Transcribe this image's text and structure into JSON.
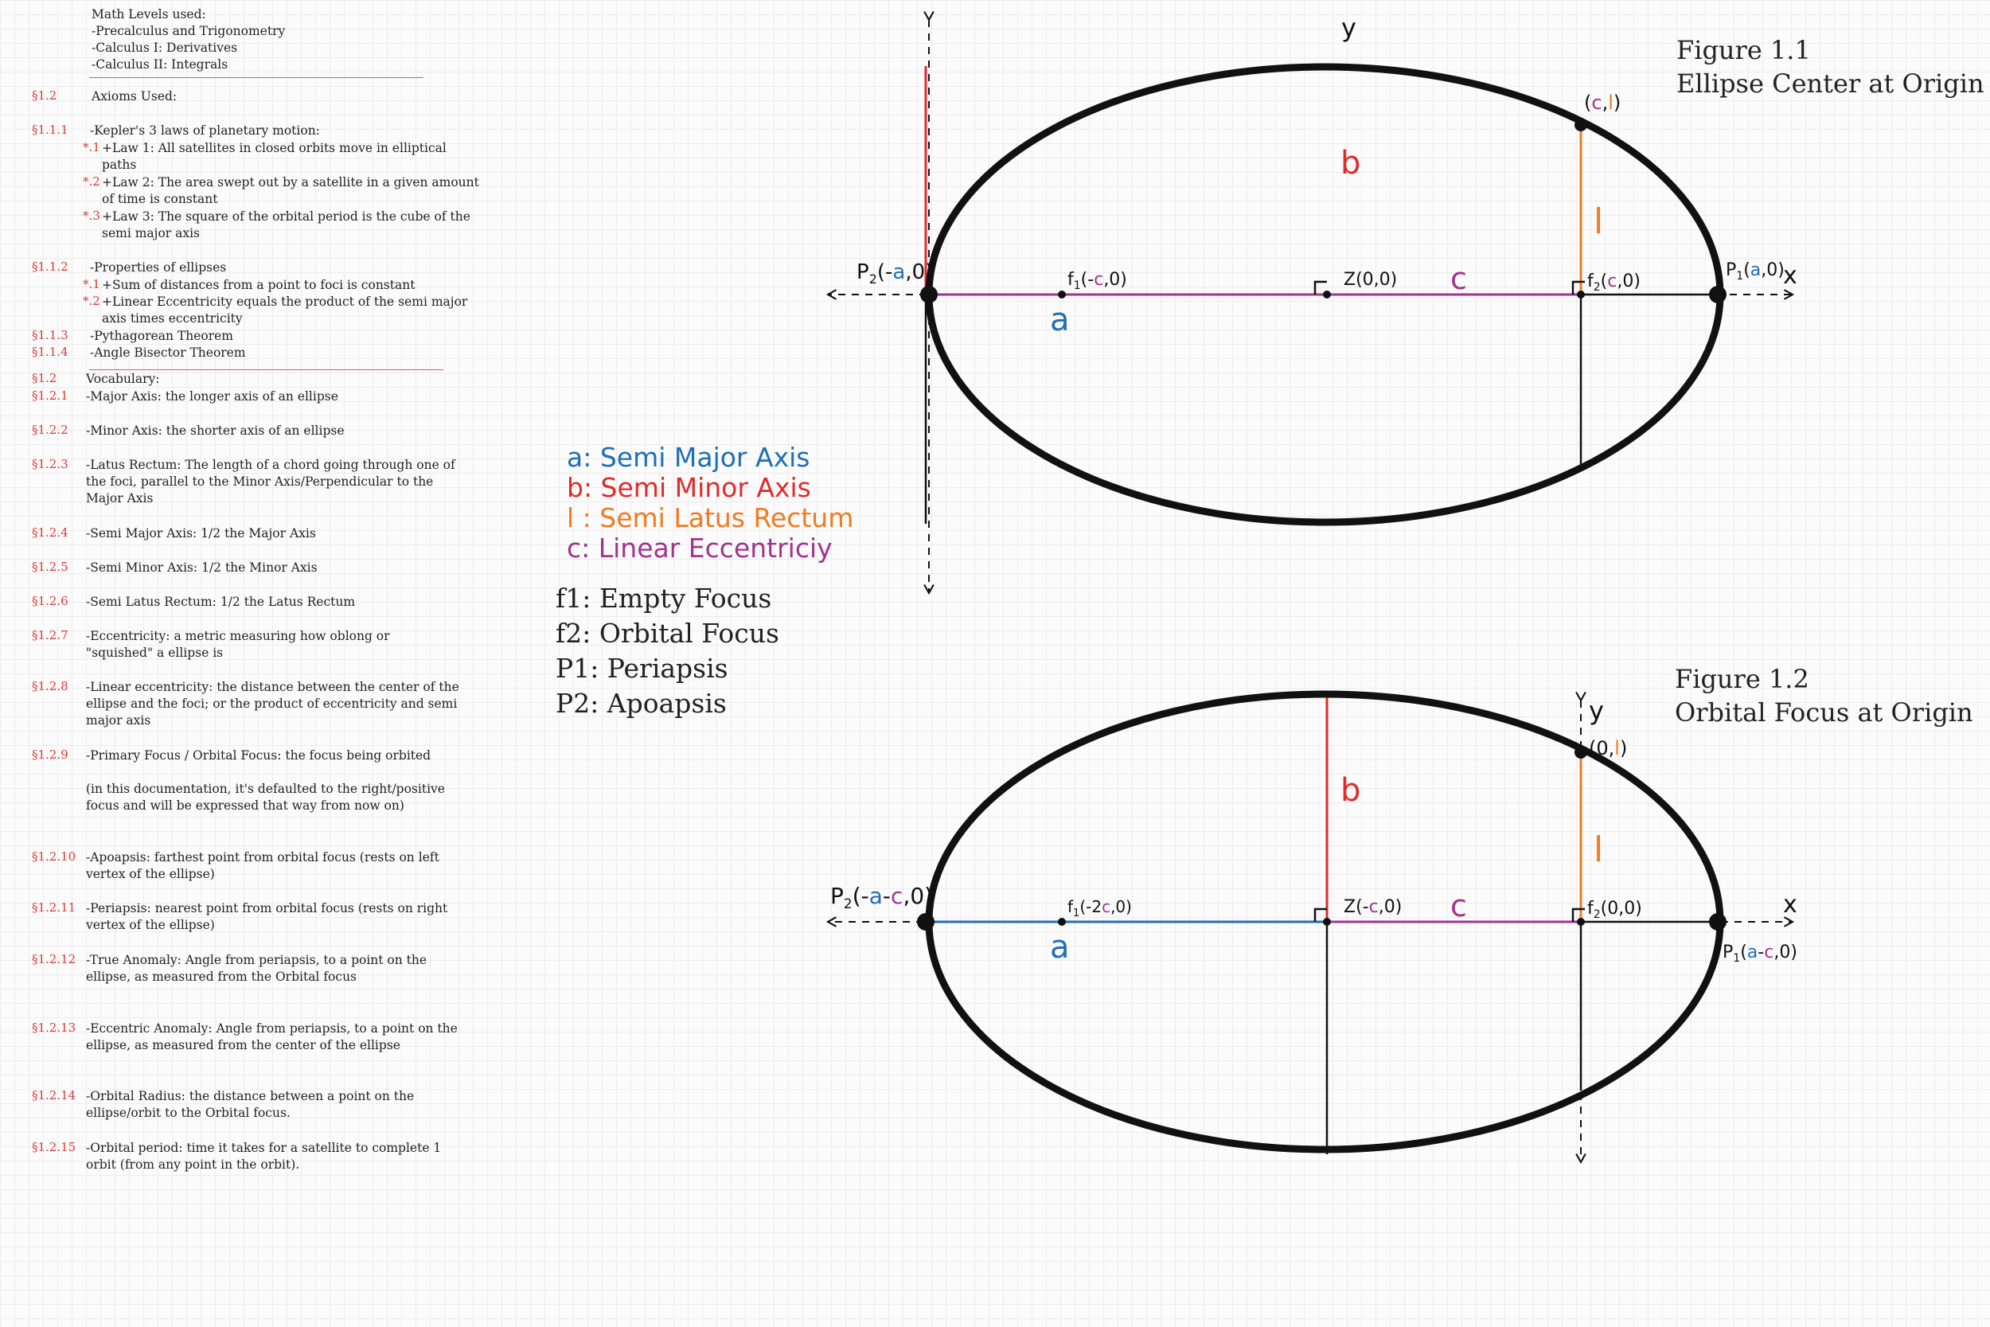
{
  "preface": {
    "lines": [
      "Math Levels used:",
      "-Precalculus and Trigonometry",
      "-Calculus I: Derivatives",
      "-Calculus II: Integrals"
    ]
  },
  "axioms": {
    "header": {
      "num": "§1.2",
      "text": "Axioms Used:"
    },
    "kepler": {
      "num": "§1.1.1",
      "text": "-Kepler's 3 laws of planetary motion:"
    },
    "laws": [
      {
        "num": "*.1",
        "text": "+Law 1: All satellites in closed orbits move in elliptical paths"
      },
      {
        "num": "*.2",
        "text": "+Law 2: The area swept out by a satellite in a given amount of time is constant"
      },
      {
        "num": "*.3",
        "text": "+Law 3: The square of the orbital period is the cube of the semi major axis"
      }
    ],
    "ellipse_props": {
      "num": "§1.1.2",
      "text": "-Properties of ellipses"
    },
    "props": [
      {
        "num": "*.1",
        "text": "+Sum of distances from a point to foci is constant"
      },
      {
        "num": "*.2",
        "text": "+Linear Eccentricity equals the product of the semi major axis times eccentricity"
      }
    ],
    "pythag": {
      "num": "§1.1.3",
      "text": "-Pythagorean Theorem"
    },
    "angle": {
      "num": "§1.1.4",
      "text": "-Angle Bisector Theorem"
    }
  },
  "vocab": {
    "header": {
      "num": "§1.2",
      "text": "Vocabulary:"
    },
    "items": [
      {
        "num": "§1.2.1",
        "text": "-Major Axis: the longer axis of an ellipse"
      },
      {
        "num": "§1.2.2",
        "text": "-Minor Axis: the shorter axis of an ellipse"
      },
      {
        "num": "§1.2.3",
        "text": "-Latus Rectum: The length of a chord going through one of the foci, parallel to the Minor Axis/Perpendicular to the Major Axis"
      },
      {
        "num": "§1.2.4",
        "text": "-Semi Major Axis: 1/2 the Major Axis"
      },
      {
        "num": "§1.2.5",
        "text": "-Semi Minor Axis: 1/2 the Minor Axis"
      },
      {
        "num": "§1.2.6",
        "text": "-Semi Latus Rectum: 1/2 the Latus Rectum"
      },
      {
        "num": "§1.2.7",
        "text": "-Eccentricity: a metric measuring how oblong or \"squished\" a ellipse is"
      },
      {
        "num": "§1.2.8",
        "text": "-Linear eccentricity: the distance between the center of the ellipse and the foci; or the product of eccentricity and semi major axis"
      },
      {
        "num": "§1.2.9",
        "text": "-Primary Focus / Orbital Focus: the focus being orbited"
      },
      {
        "num": "",
        "text": "(in this documentation, it's defaulted to the right/positive focus and will be expressed that way from now on)"
      },
      {
        "num": "§1.2.10",
        "text": "-Apoapsis: farthest point from orbital focus (rests on left vertex of the ellipse)"
      },
      {
        "num": "§1.2.11",
        "text": "-Periapsis: nearest point from orbital focus (rests on right vertex of the ellipse)"
      },
      {
        "num": "§1.2.12",
        "text": "-True Anomaly: Angle from periapsis, to a point on the ellipse, as measured from the Orbital focus"
      },
      {
        "num": "§1.2.13",
        "text": "-Eccentric Anomaly: Angle from periapsis, to a point on the ellipse, as measured from the center of the ellipse"
      },
      {
        "num": "§1.2.14",
        "text": "-Orbital Radius: the distance between a point on the ellipse/orbit to the Orbital focus."
      },
      {
        "num": "§1.2.15",
        "text": "-Orbital period: time it takes for a satellite to complete 1 orbit (from any point in the orbit)."
      }
    ]
  },
  "legend_colors": [
    {
      "text": "a: Semi Major Axis",
      "color": "#1f6fb5"
    },
    {
      "text": "b: Semi Minor Axis",
      "color": "#e02b2b"
    },
    {
      "text": "l : Semi Latus Rectum",
      "color": "#ef7b22"
    },
    {
      "text": "c: Linear Eccentriciy",
      "color": "#a2338f"
    }
  ],
  "legend_terms": [
    "f1: Empty Focus",
    "f2: Orbital Focus",
    "P1: Periapsis",
    "P2: Apoapsis"
  ],
  "colors": {
    "a": "#1f6fb5",
    "b": "#e02b2b",
    "l": "#ef7b22",
    "c": "#a2338f",
    "rule": "#e35858",
    "section_num": "#d93a3a",
    "ink": "#111111"
  },
  "figure1": {
    "title1": "Figure 1.1",
    "title2": "Ellipse Center at Origin",
    "y_axis": "y",
    "x_axis": "x",
    "label_a": "a",
    "label_b": "b",
    "label_c": "c",
    "label_l": "l",
    "p2_pre": "P",
    "p2_sub": "2",
    "p2_open": "(-",
    "p2_var": "a",
    "p2_close": ",0)",
    "f1_pre": "f",
    "f1_sub": "1",
    "f1_open": "(-",
    "f1_var": "c",
    "f1_close": ",0)",
    "z_label": "Z(0,0)",
    "f2_pre": "f",
    "f2_sub": "2",
    "f2_open": "(",
    "f2_var": "c",
    "f2_close": ",0)",
    "p1_pre": "P",
    "p1_sub": "1",
    "p1_open": "(",
    "p1_var": "a",
    "p1_close": ",0)",
    "top_open": "(",
    "top_var1": "c",
    "top_comma": ",",
    "top_var2": "l",
    "top_close": ")"
  },
  "figure2": {
    "title1": "Figure 1.2",
    "title2": "Orbital Focus at Origin",
    "y_axis": "y",
    "x_axis": "x",
    "label_a": "a",
    "label_b": "b",
    "label_c": "c",
    "label_l": "l",
    "p2_pre": "P",
    "p2_sub": "2",
    "p2_open": "(-",
    "p2_var1": "a",
    "p2_dash": "-",
    "p2_var2": "c",
    "p2_close": ",0)",
    "f1_pre": "f",
    "f1_sub": "1",
    "f1_open": "(-2",
    "f1_var": "c",
    "f1_close": ",0)",
    "z_open": "Z(-",
    "z_var": "c",
    "z_close": ",0)",
    "f2_pre": "f",
    "f2_sub": "2",
    "f2_rest": "(0,0)",
    "p1_pre": "P",
    "p1_sub": "1",
    "p1_open": "(",
    "p1_var1": "a",
    "p1_dash": "-",
    "p1_var2": "c",
    "p1_close": ",0)",
    "top_open": "(0,",
    "top_var": "l",
    "top_close": ")"
  }
}
